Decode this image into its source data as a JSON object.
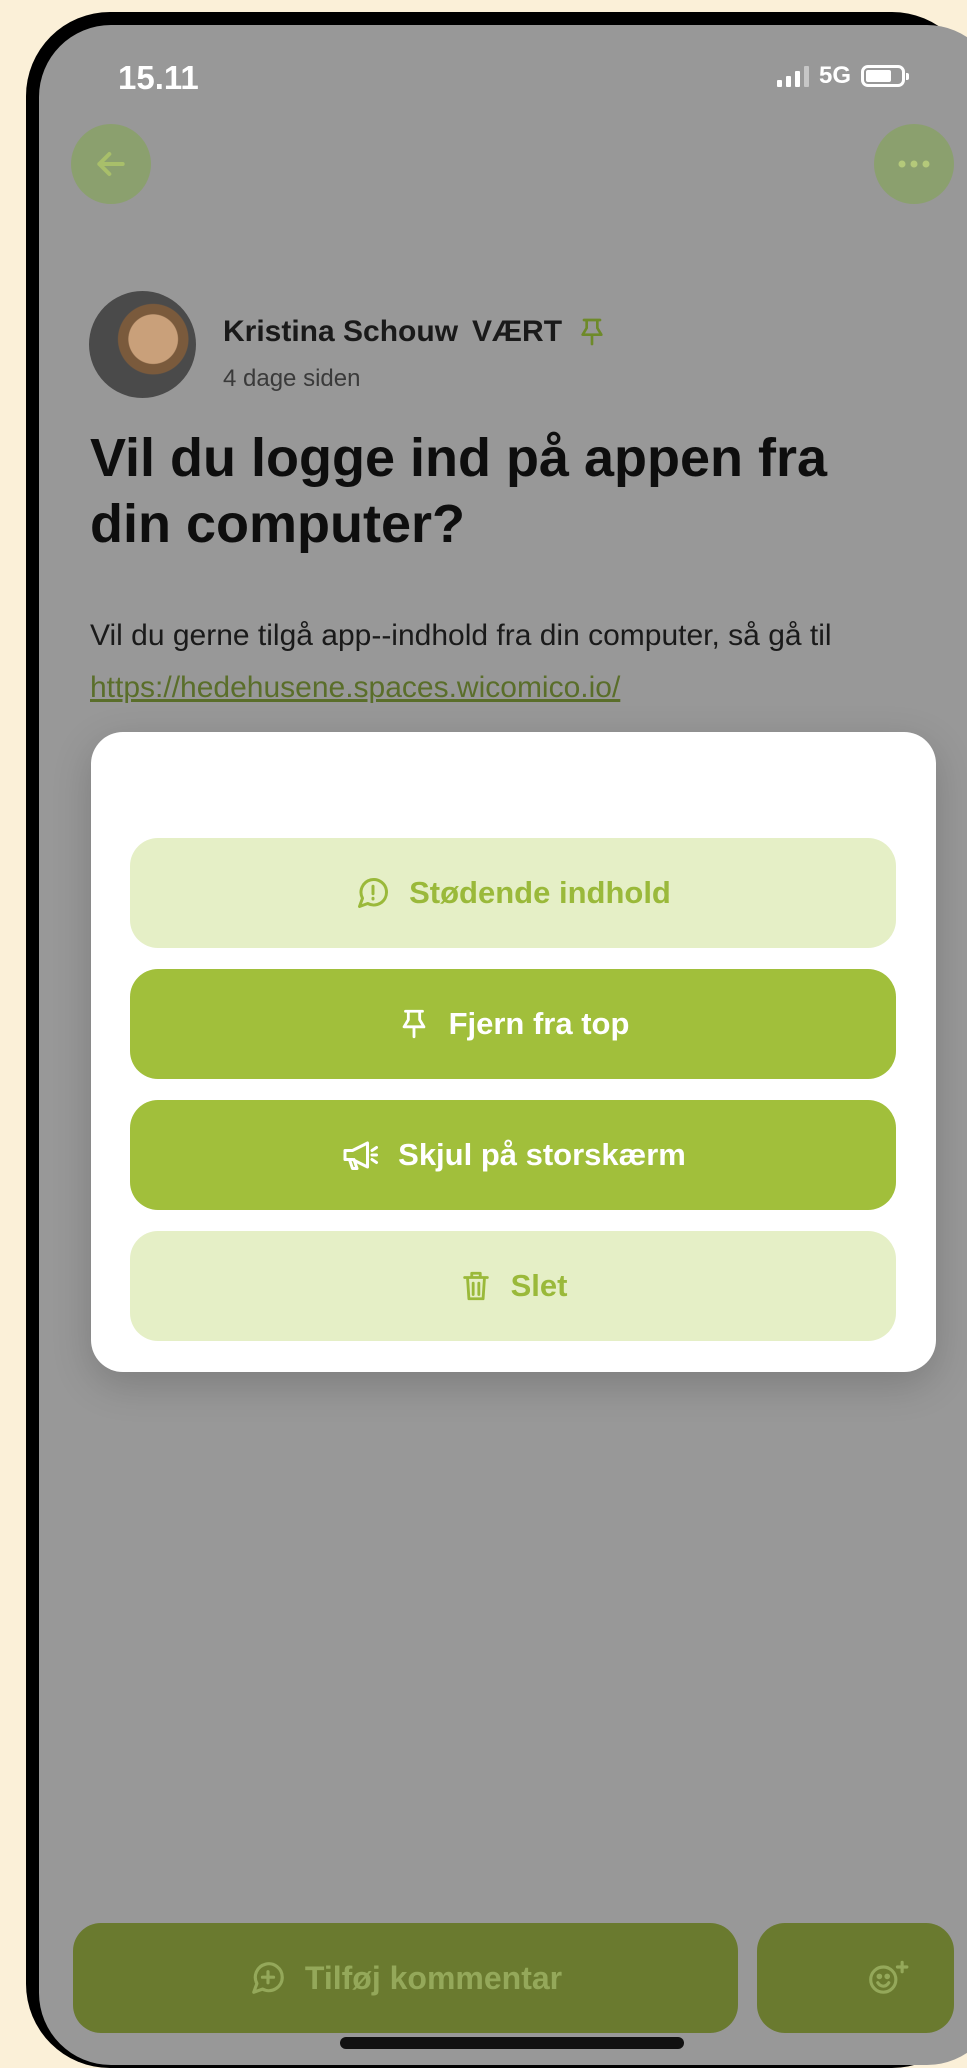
{
  "status_bar": {
    "time": "15.11",
    "network": "5G"
  },
  "post": {
    "author": "Kristina Schouw",
    "host_badge": "VÆRT",
    "posted": "4 dage siden",
    "title": "Vil du logge ind på appen fra din computer?",
    "body_text": "Vil du gerne tilgå app--indhold fra din computer, så gå til ",
    "body_link": "https://hedehusene.spaces.wicomico.io/"
  },
  "menu": {
    "items": [
      {
        "label": "Stødende indhold",
        "icon": "report-icon"
      },
      {
        "label": "Fjern fra top",
        "icon": "pin-icon"
      },
      {
        "label": "Skjul på storskærm",
        "icon": "megaphone-icon"
      },
      {
        "label": "Slet",
        "icon": "trash-icon"
      }
    ]
  },
  "footer": {
    "comment_label": "Tilføj kommentar"
  },
  "colors": {
    "accent": "#a1bf3b",
    "accent_light": "#e5efc6",
    "overlay": "#989898",
    "footer_button": "#6a7a2f"
  }
}
